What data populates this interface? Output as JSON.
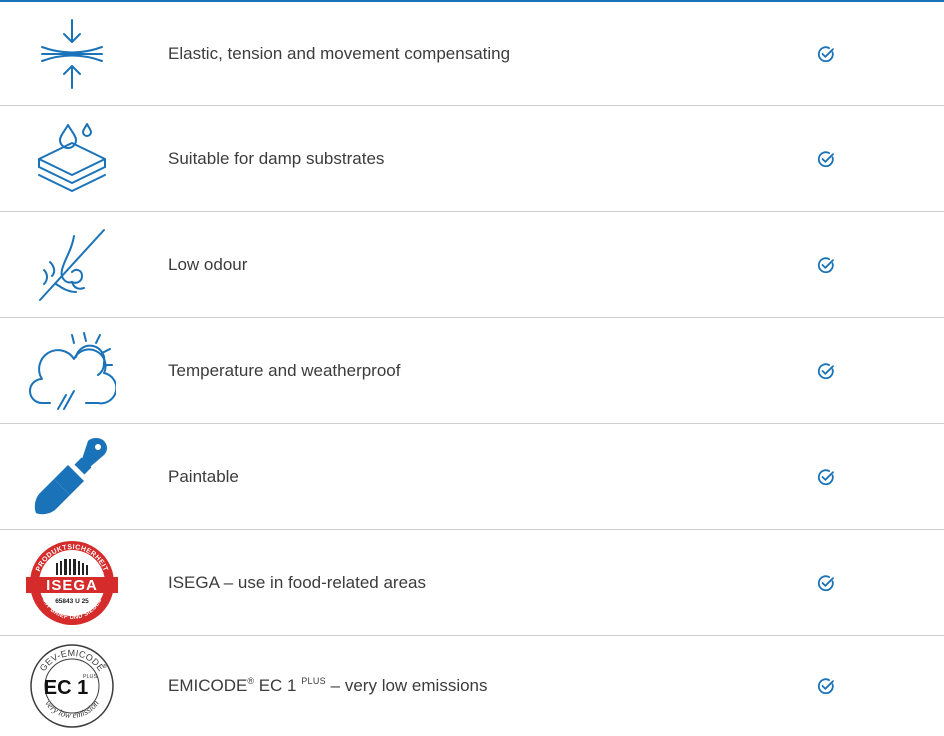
{
  "features": [
    {
      "label": "Elastic, tension and movement compensating",
      "icon": "compression-arrows-icon",
      "checked": true
    },
    {
      "label": "Suitable for damp substrates",
      "icon": "damp-layers-icon",
      "checked": true
    },
    {
      "label": "Low odour",
      "icon": "no-odour-nose-icon",
      "checked": true
    },
    {
      "label": "Temperature and weatherproof",
      "icon": "weather-cloud-sun-icon",
      "checked": true
    },
    {
      "label": "Paintable",
      "icon": "paintbrush-icon",
      "checked": true
    },
    {
      "label": "ISEGA – use in food-related areas",
      "icon": "isega-seal-icon",
      "checked": true,
      "seal": {
        "top_text": "PRODUKTSICHERHEIT",
        "brand": "ISEGA",
        "code": "65843 U 25",
        "bottom_text": "MIT BRIEF UND SIEGEL"
      }
    },
    {
      "label_main": "EMICODE",
      "label_reg": "®",
      "label_mid": " EC 1 ",
      "label_sup": "PLUS",
      "label_end": " – very low emissions",
      "icon": "emicode-seal-icon",
      "checked": true,
      "seal": {
        "top_text": "GEV-EMICODE",
        "reg": "®",
        "code": "EC 1",
        "plus": "PLUS",
        "bottom_text": "very low emission"
      }
    }
  ],
  "colors": {
    "accent": "#1a73b8",
    "text": "#3c3c3c",
    "divider": "#cfcfcf",
    "isega_red": "#d52b2b"
  }
}
